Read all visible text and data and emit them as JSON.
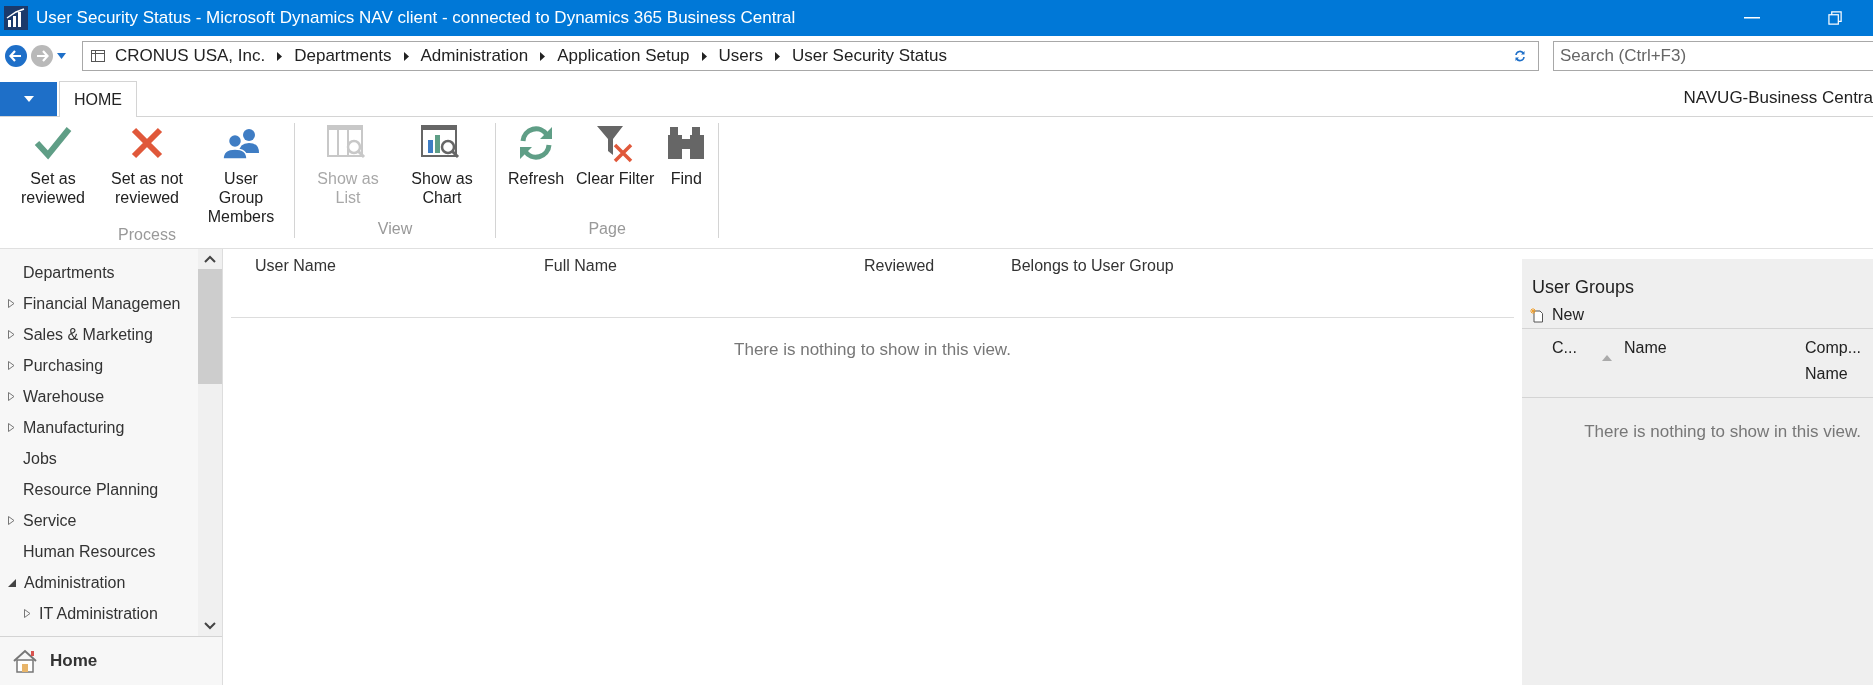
{
  "window": {
    "title": "User Security Status - Microsoft Dynamics NAV client - connected to Dynamics 365 Business Central"
  },
  "breadcrumb": [
    "CRONUS USA, Inc.",
    "Departments",
    "Administration",
    "Application Setup",
    "Users",
    "User Security Status"
  ],
  "search": {
    "placeholder": "Search (Ctrl+F3)"
  },
  "tabs": [
    {
      "label": "HOME",
      "selected": true
    }
  ],
  "company_label": "NAVUG-Business Centra",
  "ribbon": [
    {
      "label": "Process",
      "actions": [
        {
          "kind": "check",
          "label": "Set as reviewed",
          "disabled": false
        },
        {
          "kind": "cross",
          "label": "Set as not reviewed",
          "disabled": false
        },
        {
          "kind": "users",
          "label": "User Group Members",
          "disabled": false
        }
      ]
    },
    {
      "label": "View",
      "actions": [
        {
          "kind": "list",
          "label": "Show as List",
          "disabled": true
        },
        {
          "kind": "chart",
          "label": "Show as Chart",
          "disabled": false
        }
      ]
    },
    {
      "label": "Page",
      "actions": [
        {
          "kind": "refresh",
          "label": "Refresh",
          "disabled": false
        },
        {
          "kind": "clearfilter",
          "label": "Clear Filter",
          "disabled": false
        },
        {
          "kind": "find",
          "label": "Find",
          "disabled": false
        }
      ]
    }
  ],
  "sidebar": {
    "items": [
      {
        "label": "Departments",
        "expandable": false
      },
      {
        "label": "Financial Managemen",
        "expandable": true,
        "expanded": false
      },
      {
        "label": "Sales & Marketing",
        "expandable": true,
        "expanded": false
      },
      {
        "label": "Purchasing",
        "expandable": true,
        "expanded": false
      },
      {
        "label": "Warehouse",
        "expandable": true,
        "expanded": false
      },
      {
        "label": "Manufacturing",
        "expandable": true,
        "expanded": false
      },
      {
        "label": "Jobs",
        "expandable": false
      },
      {
        "label": "Resource Planning",
        "expandable": false
      },
      {
        "label": "Service",
        "expandable": true,
        "expanded": false
      },
      {
        "label": "Human Resources",
        "expandable": false
      },
      {
        "label": "Administration",
        "expandable": true,
        "expanded": true,
        "children": [
          {
            "label": "IT Administration",
            "expandable": true,
            "expanded": false
          }
        ]
      }
    ],
    "home": "Home"
  },
  "table": {
    "columns": [
      "User Name",
      "Full Name",
      "Reviewed",
      "Belongs to User Group"
    ],
    "empty_message": "There is nothing to show in this view."
  },
  "user_groups": {
    "title": "User Groups",
    "new_action": "New",
    "columns": [
      "C...",
      "Name",
      "Comp... Name"
    ],
    "empty_message": "There is nothing to show in this view."
  }
}
